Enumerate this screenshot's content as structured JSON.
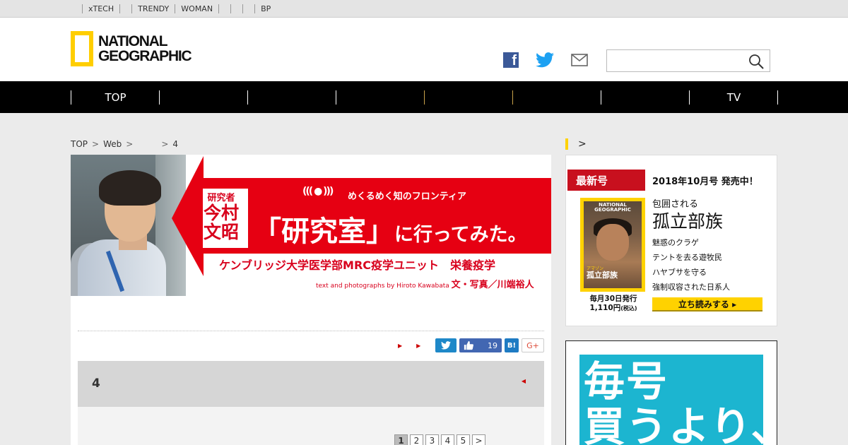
{
  "topbar": {
    "links": [
      "",
      "xTECH",
      "",
      "",
      "TRENDY",
      "WOMAN",
      "",
      "",
      "",
      "BP"
    ]
  },
  "header": {
    "logo_line1": "NATIONAL",
    "logo_line2": "GEOGRAPHIC",
    "search_placeholder": ""
  },
  "nav": {
    "items": [
      "TOP",
      "",
      "",
      "",
      "",
      "",
      "",
      "TV"
    ]
  },
  "breadcrumb": {
    "items": [
      "TOP",
      "Web",
      "",
      "4"
    ],
    "separator": ">"
  },
  "banner": {
    "researcher_label": "研究者",
    "researcher_name_1": "今村",
    "researcher_name_2": "文昭",
    "waves": "((( ● )))",
    "tagline": "めくるめく知のフロンティア",
    "title_open": "「",
    "title_main": "研究室",
    "title_close": "」",
    "title_suffix": "に行ってみた。",
    "affiliation": "ケンブリッジ大学医学部MRC疫学ユニット　栄養疫学",
    "credit_en": "text and photographs by Hiroto Kawabata",
    "credit_jp": "文・写真／川端裕人",
    "accent": "#e60012"
  },
  "article": {
    "share": {
      "like_count": "19",
      "hatena_label": "B!",
      "gplus_label": "G+"
    },
    "subhead_number": "4",
    "pages": [
      "1",
      "2",
      "3",
      "4",
      "5",
      ">"
    ],
    "current_page": "1"
  },
  "sidebar": {
    "heading": ">",
    "new_issue_label": "最新号",
    "issue_date": "2018年10月号 発売中！",
    "cover_title_1": "NATIONAL",
    "cover_title_2": "GEOGRAPHIC",
    "cover_kicker": "アマゾン",
    "cover_headline": "包囲される孤立部族",
    "headline_small": "包囲される",
    "headline_big": "孤立部族",
    "toc": [
      "魅惑のクラゲ",
      "テントを去る遊牧民",
      "ハヤブサを守る",
      "強制収容された日系人"
    ],
    "monthly_1": "毎月30日発行",
    "monthly_2": "1,110円",
    "monthly_tax": "(税込)",
    "read_button": "立ち読みする ▸"
  },
  "ad": {
    "line1": "毎号",
    "line2": "買うより、"
  }
}
